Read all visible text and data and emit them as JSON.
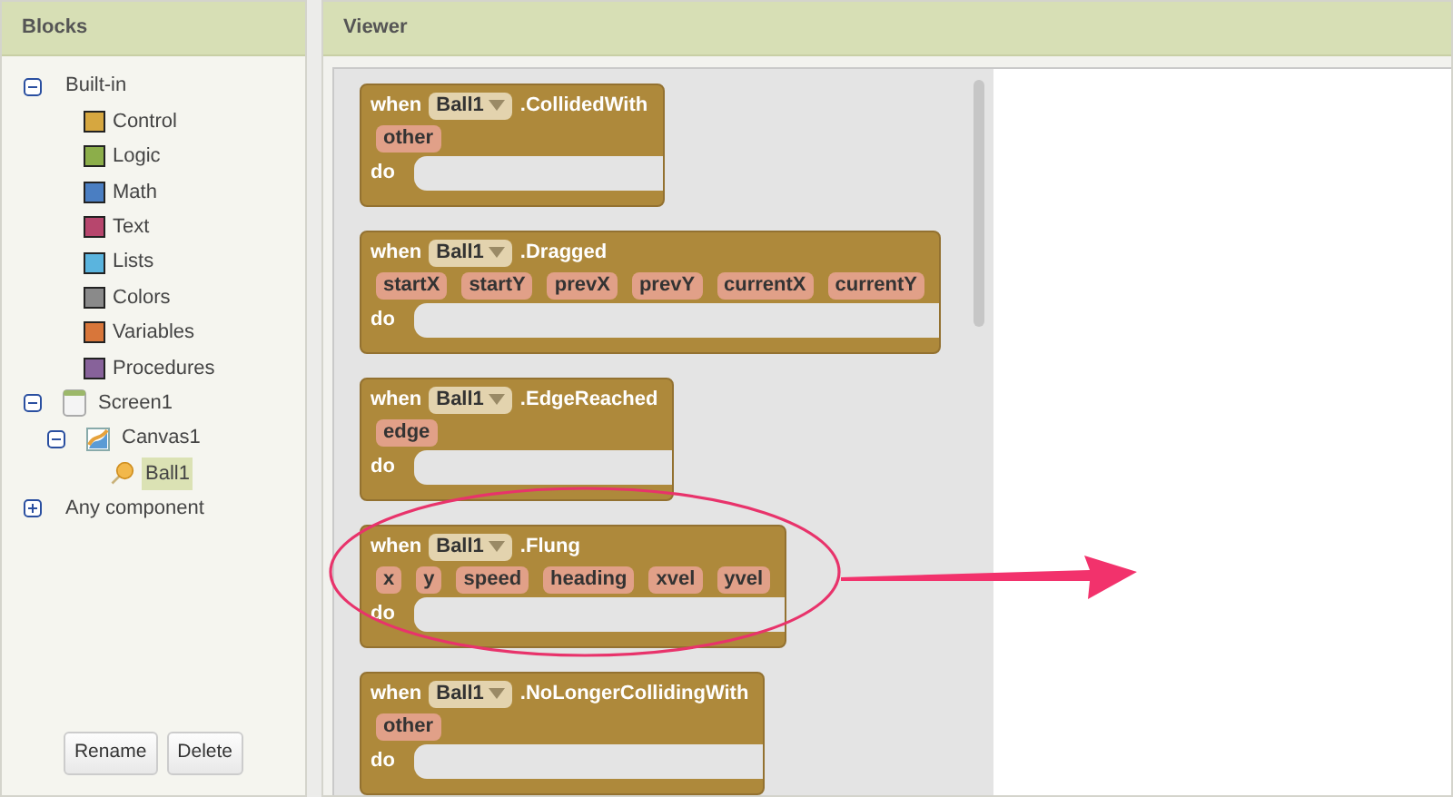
{
  "blocks_panel": {
    "title": "Blocks",
    "tree": [
      {
        "label": "Built-in",
        "kind": "group",
        "expanded": true,
        "selected": false,
        "children": [
          {
            "label": "Control",
            "kind": "category",
            "color": "#d6a740",
            "selected": false
          },
          {
            "label": "Logic",
            "kind": "category",
            "color": "#8cae4a",
            "selected": false
          },
          {
            "label": "Math",
            "kind": "category",
            "color": "#4a7ec2",
            "selected": false
          },
          {
            "label": "Text",
            "kind": "category",
            "color": "#b7466d",
            "selected": false
          },
          {
            "label": "Lists",
            "kind": "category",
            "color": "#5ab4de",
            "selected": false
          },
          {
            "label": "Colors",
            "kind": "category",
            "color": "#8a8a8a",
            "selected": false
          },
          {
            "label": "Variables",
            "kind": "category",
            "color": "#d8763a",
            "selected": false
          },
          {
            "label": "Procedures",
            "kind": "category",
            "color": "#87629a",
            "selected": false
          }
        ]
      },
      {
        "label": "Screen1",
        "kind": "screen",
        "expanded": true,
        "selected": false,
        "children": [
          {
            "label": "Canvas1",
            "kind": "canvas",
            "expanded": true,
            "selected": false,
            "children": [
              {
                "label": "Ball1",
                "kind": "ball",
                "selected": true
              }
            ]
          }
        ]
      },
      {
        "label": "Any component",
        "kind": "group",
        "expanded": false,
        "selected": false
      }
    ],
    "buttons": [
      "Rename",
      "Delete"
    ]
  },
  "viewer": {
    "title": "Viewer",
    "blocks": [
      {
        "when": "when",
        "component": "Ball1",
        "event": ".CollidedWith",
        "params": [
          "other"
        ],
        "do": "do"
      },
      {
        "when": "when",
        "component": "Ball1",
        "event": ".Dragged",
        "params": [
          "startX",
          "startY",
          "prevX",
          "prevY",
          "currentX",
          "currentY"
        ],
        "do": "do"
      },
      {
        "when": "when",
        "component": "Ball1",
        "event": ".EdgeReached",
        "params": [
          "edge"
        ],
        "do": "do"
      },
      {
        "when": "when",
        "component": "Ball1",
        "event": ".Flung",
        "params": [
          "x",
          "y",
          "speed",
          "heading",
          "xvel",
          "yvel"
        ],
        "do": "do"
      },
      {
        "when": "when",
        "component": "Ball1",
        "event": ".NoLongerCollidingWith",
        "params": [
          "other"
        ],
        "do": "do"
      }
    ]
  }
}
